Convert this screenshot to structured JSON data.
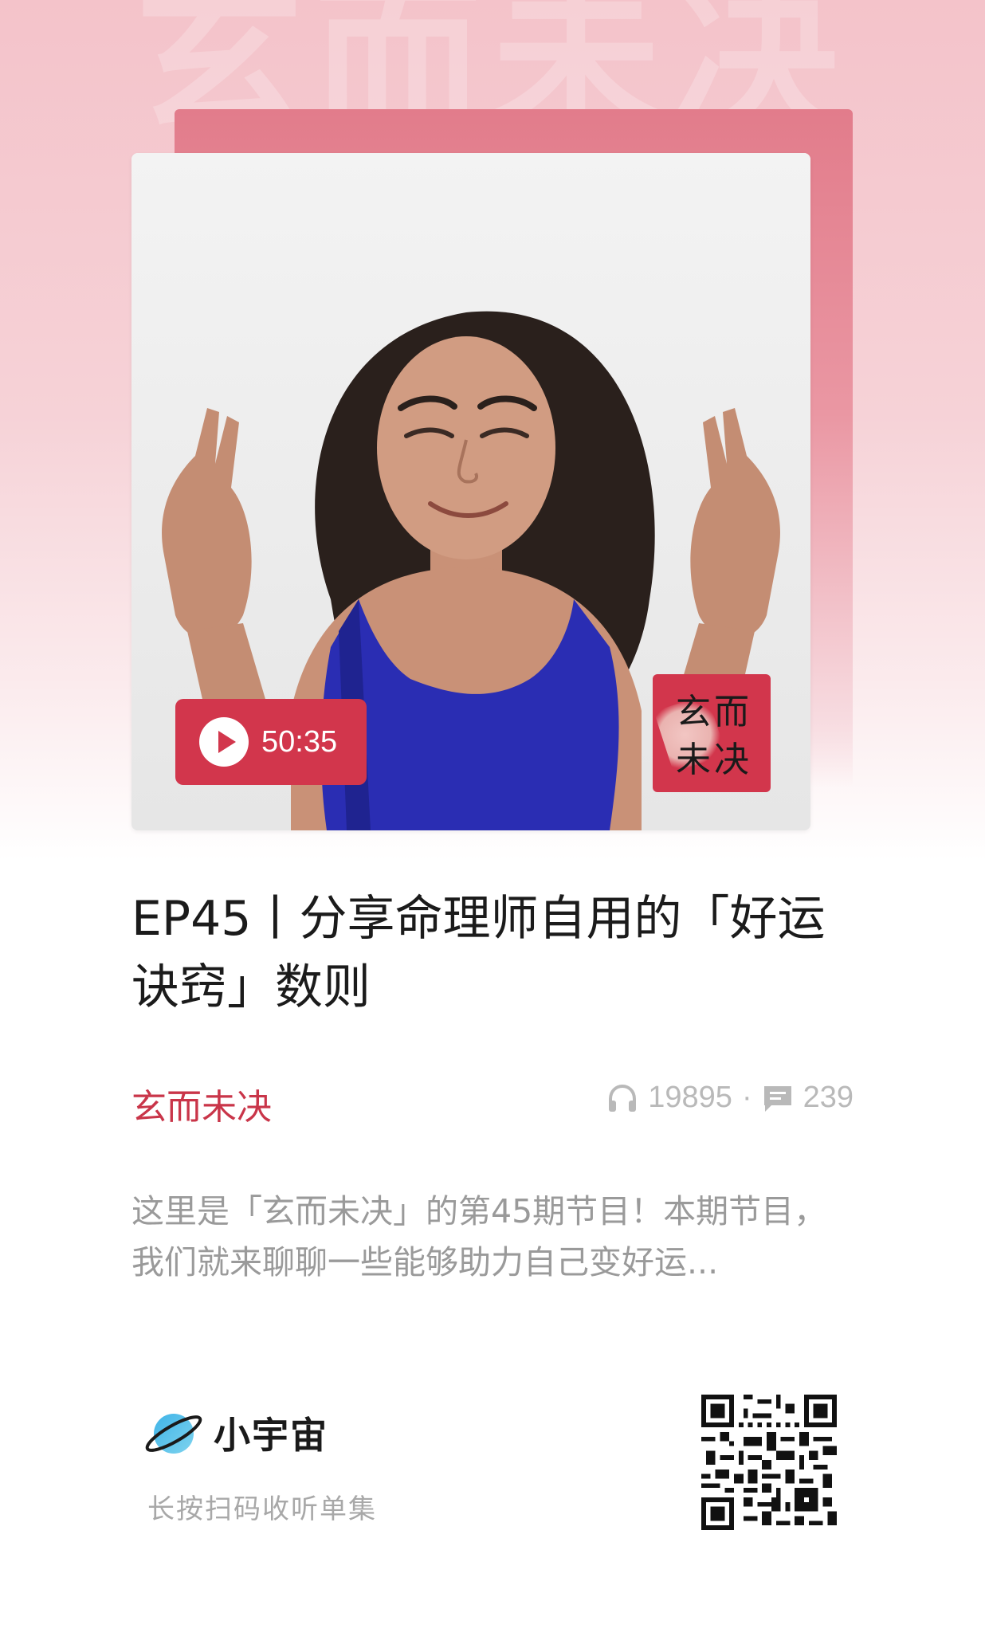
{
  "background": {
    "watermark_text": "玄而未决"
  },
  "cover": {
    "duration": "50:35",
    "badge_line1": "玄而",
    "badge_line2": "未决"
  },
  "episode": {
    "title": "EP45丨分享命理师自用的「好运诀窍」数则",
    "podcast_name": "玄而未决",
    "plays": "19895",
    "separator": "·",
    "comments": "239",
    "description": "这里是「玄而未决」的第45期节目！本期节目，我们就来聊聊一些能够助力自己变好运..."
  },
  "footer": {
    "brand": "小宇宙",
    "scan_hint": "长按扫码收听单集"
  },
  "colors": {
    "accent": "#d2364c",
    "title": "#1b1b1b",
    "muted": "#9a9a9a"
  },
  "icons": [
    "play-icon",
    "headphones-icon",
    "comment-icon",
    "xiaoyuzhou-logo-icon",
    "qr-code"
  ]
}
